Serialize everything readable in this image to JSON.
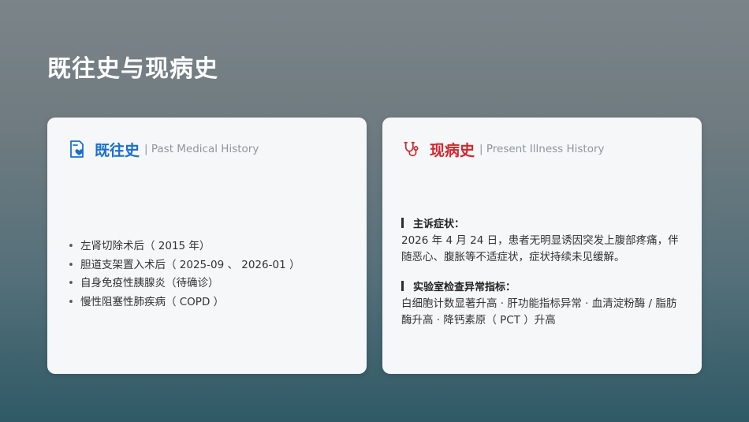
{
  "page": {
    "title": "既往史与现病史"
  },
  "past_history": {
    "title": "既往史",
    "subtitle": "| Past Medical History",
    "icon": "medical-record-heart-icon",
    "items": [
      "左肾切除术后（ 2015 年）",
      "胆道支架置入术后（ 2025-09 、 2026-01 ）",
      "自身免疫性胰腺炎（待确诊）",
      "慢性阻塞性肺疾病（ COPD ）"
    ]
  },
  "present_illness": {
    "title": "现病史",
    "subtitle": "| Present Illness History",
    "icon": "stethoscope-icon",
    "complaint_heading": "主诉症状：",
    "complaint_text": "2026 年 4 月 24 日，患者无明显诱因突发上腹部疼痛，伴随恶心、腹胀等不适症状，症状持续未见缓解。",
    "lab_heading": "实验室检查异常指标：",
    "lab_text": "白细胞计数显著升高 · 肝功能指标异常 · 血清淀粉酶 / 脂肪酶升高 · 降钙素原（ PCT ）升高"
  },
  "colors": {
    "past_accent": "#1a6fd0",
    "present_accent": "#d0282e"
  }
}
